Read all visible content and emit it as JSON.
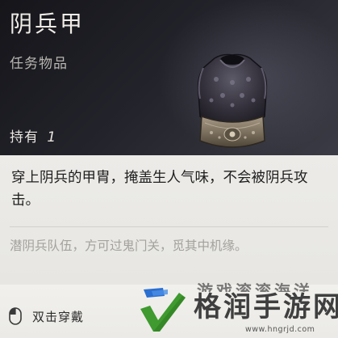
{
  "item": {
    "name": "阴兵甲",
    "category": "任务物品",
    "owned_label": "持有",
    "owned_count": "1",
    "image_icon": "armor-vest-icon",
    "description": "穿上阴兵的甲胄，掩盖生人气味，不会被阴兵攻击。",
    "lore": "潜阴兵队伍，方可过鬼门关，觅其中机缘。"
  },
  "actions": {
    "equip_icon": "mouse-icon",
    "equip_label": "双击穿戴"
  },
  "watermark": {
    "top_text": "游戏滚滚海洋",
    "name": "格润手游网",
    "url": "www.hngrjd.com",
    "logo_icon": "checkmark-logo-icon"
  },
  "colors": {
    "header_dark": "#1c1c22",
    "body_paper": "#ebeae7",
    "logo_green": "#3f9a2f",
    "logo_blue": "#2a6fd1"
  }
}
